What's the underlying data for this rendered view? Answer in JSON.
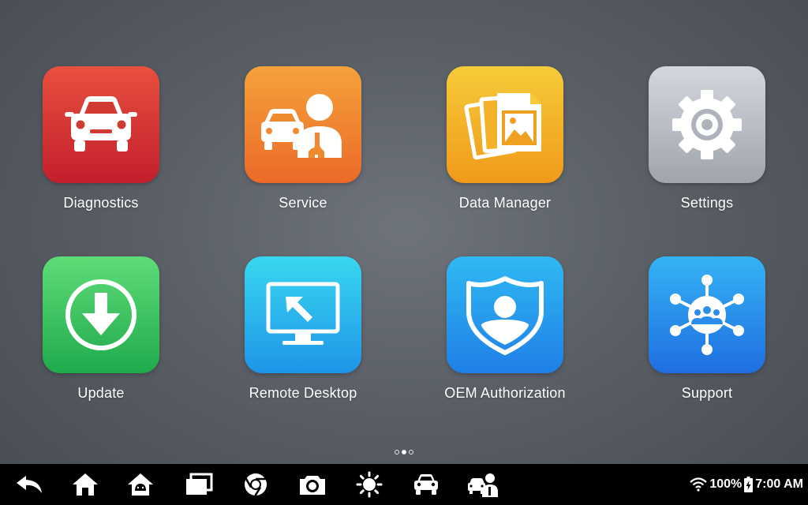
{
  "launcher": {
    "apps": [
      {
        "label": "Diagnostics",
        "icon": "car-front-icon",
        "color": "#d8342f"
      },
      {
        "label": "Service",
        "icon": "car-technician-icon",
        "color": "#f08a2f"
      },
      {
        "label": "Data Manager",
        "icon": "photo-files-icon",
        "color": "#f3b229"
      },
      {
        "label": "Settings",
        "icon": "gear-icon",
        "color": "#b9bdc4"
      },
      {
        "label": "Update",
        "icon": "download-arrow-icon",
        "color": "#34c05a"
      },
      {
        "label": "Remote Desktop",
        "icon": "monitor-cursor-icon",
        "color": "#27b4ec"
      },
      {
        "label": "OEM Authorization",
        "icon": "shield-user-icon",
        "color": "#2299ec"
      },
      {
        "label": "Support",
        "icon": "network-users-icon",
        "color": "#2a8ceb"
      }
    ],
    "pages": {
      "count": 3,
      "current": 2
    }
  },
  "taskbar": {
    "buttons": [
      {
        "icon": "back-arrow-icon"
      },
      {
        "icon": "home-icon"
      },
      {
        "icon": "android-home-icon"
      },
      {
        "icon": "recent-windows-icon"
      },
      {
        "icon": "chrome-browser-icon"
      },
      {
        "icon": "camera-icon"
      },
      {
        "icon": "brightness-icon"
      },
      {
        "icon": "car-icon"
      },
      {
        "icon": "car-technician-icon"
      }
    ],
    "status": {
      "wifi_icon": "wifi-icon",
      "battery_percent": "100%",
      "battery_icon": "battery-charging-icon",
      "time": "7:00 AM"
    }
  }
}
